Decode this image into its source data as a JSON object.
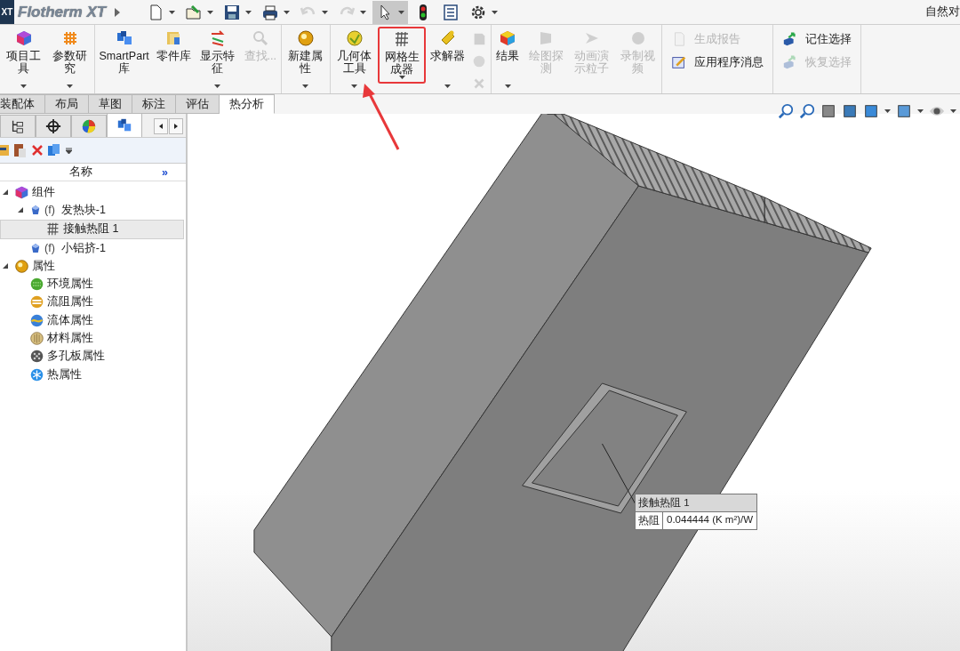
{
  "title_bar": {
    "logo": "XT",
    "app_name": "Flotherm XT",
    "user_text": "自然对"
  },
  "quick_access": [
    {
      "dropdown": true,
      "disabled": false,
      "pressed": false
    },
    {
      "dropdown": true,
      "disabled": false,
      "pressed": false
    },
    {
      "dropdown": true,
      "disabled": false,
      "pressed": false
    },
    {
      "dropdown": true,
      "disabled": false,
      "pressed": false
    },
    {
      "dropdown": true,
      "disabled": true,
      "pressed": false
    },
    {
      "dropdown": true,
      "disabled": true,
      "pressed": false
    },
    {
      "dropdown": true,
      "disabled": false,
      "pressed": true
    },
    {
      "dropdown": false,
      "disabled": false,
      "pressed": false
    },
    {
      "dropdown": false,
      "disabled": false,
      "pressed": false
    },
    {
      "dropdown": true,
      "disabled": false,
      "pressed": false
    }
  ],
  "ribbon": {
    "groups": [
      {
        "items": [
          {
            "kind": "large",
            "label": "项目工具",
            "dropdown": true,
            "disabled": false
          },
          {
            "kind": "large",
            "label": "参数研究",
            "dropdown": true,
            "disabled": false
          }
        ]
      },
      {
        "items": [
          {
            "kind": "large",
            "label": "SmartPart库",
            "dropdown": false,
            "disabled": false
          },
          {
            "kind": "large",
            "label": "零件库",
            "dropdown": false,
            "disabled": false
          },
          {
            "kind": "large",
            "label": "显示特征",
            "dropdown": true,
            "disabled": false
          },
          {
            "kind": "large",
            "label": "查找...",
            "dropdown": false,
            "disabled": true
          }
        ]
      },
      {
        "items": [
          {
            "kind": "large",
            "label": "新建属性",
            "dropdown": true,
            "disabled": false
          }
        ]
      },
      {
        "items": [
          {
            "kind": "large",
            "label": "几何体工具",
            "dropdown": true,
            "disabled": false
          },
          {
            "kind": "large",
            "label": "网格生成器",
            "dropdown": true,
            "disabled": false
          },
          {
            "kind": "large",
            "label": "求解器",
            "dropdown": true,
            "disabled": false
          },
          {
            "kind": "column",
            "icons": [
              {
                "disabled": true
              },
              {
                "disabled": true
              },
              {
                "disabled": true
              }
            ]
          }
        ]
      },
      {
        "items": [
          {
            "kind": "large",
            "label": "结果",
            "dropdown": true,
            "disabled": false
          },
          {
            "kind": "large",
            "label": "绘图探测",
            "dropdown": false,
            "disabled": true
          },
          {
            "kind": "large",
            "label": "动画演示粒子",
            "dropdown": false,
            "disabled": true
          },
          {
            "kind": "large",
            "label": "录制视频",
            "dropdown": false,
            "disabled": true
          }
        ]
      },
      {
        "items": [
          {
            "kind": "list",
            "rows": [
              {
                "label": "生成报告",
                "disabled": true
              },
              {
                "label": "应用程序消息",
                "disabled": false
              }
            ]
          }
        ]
      },
      {
        "items": [
          {
            "kind": "list",
            "rows": [
              {
                "label": "记住选择",
                "disabled": false
              },
              {
                "label": "恢复选择",
                "disabled": true
              }
            ]
          }
        ]
      }
    ]
  },
  "ribbon_tabs": [
    {
      "label": "装配体",
      "selected": false
    },
    {
      "label": "布局",
      "selected": false
    },
    {
      "label": "草图",
      "selected": false
    },
    {
      "label": "标注",
      "selected": false
    },
    {
      "label": "评估",
      "selected": false
    },
    {
      "label": "热分析",
      "selected": true
    }
  ],
  "panel": {
    "tabs": [
      {
        "selected": false
      },
      {
        "selected": false
      },
      {
        "selected": false
      },
      {
        "selected": true
      }
    ],
    "column_header": "名称",
    "expand_button": "»",
    "tree": [
      {
        "label": "组件",
        "expanded": true,
        "selected": false,
        "children": [
          {
            "label": "发热块-1",
            "prefix": "(f)",
            "expanded": true,
            "selected": false,
            "children": [
              {
                "label": "接触热阻 1",
                "selected": true
              }
            ]
          },
          {
            "label": "小铝挤-1",
            "prefix": "(f)",
            "selected": false
          }
        ]
      },
      {
        "label": "属性",
        "expanded": true,
        "selected": false,
        "children": [
          {
            "label": "环境属性",
            "selected": false
          },
          {
            "label": "流阻属性",
            "selected": false
          },
          {
            "label": "流体属性",
            "selected": false
          },
          {
            "label": "材料属性",
            "selected": false
          },
          {
            "label": "多孔板属性",
            "selected": false
          },
          {
            "label": "热属性",
            "selected": false
          }
        ]
      }
    ]
  },
  "callout": {
    "title": "接触热阻 1",
    "property": "热阻",
    "value": "0.044444 (K m²)/W"
  }
}
